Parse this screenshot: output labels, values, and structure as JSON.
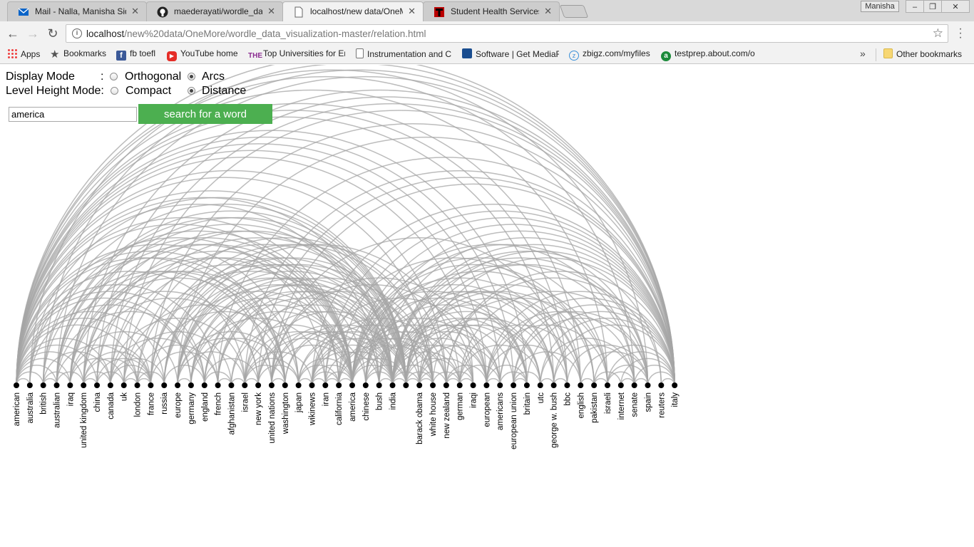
{
  "browser": {
    "tabs": [
      {
        "title": "Mail - Nalla, Manisha Sid",
        "icon": "outlook-mail-icon",
        "active": false
      },
      {
        "title": "maederayati/wordle_data",
        "icon": "github-icon",
        "active": false
      },
      {
        "title": "localhost/new data/OneM",
        "icon": "page-icon",
        "active": true
      },
      {
        "title": "Student Health Services",
        "icon": "texas-tech-icon",
        "active": false
      }
    ],
    "profile_name": "Manisha",
    "url_host": "localhost",
    "url_path": "/new%20data/OneMore/wordle_data_visualization-master/relation.html",
    "bookmarks": [
      {
        "label": "Apps",
        "icon": "apps-grid-icon"
      },
      {
        "label": "Bookmarks",
        "icon": "star-icon"
      },
      {
        "label": "fb toefl",
        "icon": "facebook-icon"
      },
      {
        "label": "YouTube home",
        "icon": "youtube-icon"
      },
      {
        "label": "Top Universities for Er",
        "icon": "the-icon"
      },
      {
        "label": "Instrumentation and C",
        "icon": "page-icon"
      },
      {
        "label": "Software | Get MediaF",
        "icon": "mediafire-icon"
      },
      {
        "label": "zbigz.com/myfiles",
        "icon": "zbigz-icon"
      },
      {
        "label": "testprep.about.com/o",
        "icon": "about-icon"
      }
    ],
    "overflow": "»",
    "other_bookmarks": "Other bookmarks",
    "colors": {
      "tabstrip": "#d9d9d9",
      "toolbar": "#f2f2f2"
    }
  },
  "page": {
    "display_mode": {
      "label": "Display Mode",
      "colon": ":",
      "options": [
        "Orthogonal",
        "Arcs"
      ],
      "selected": "Arcs"
    },
    "level_height_mode": {
      "label": "Level Height Mode:",
      "options": [
        "Compact",
        "Distance"
      ],
      "selected": "Distance"
    },
    "search": {
      "value": "america",
      "button_label": "search for a word"
    },
    "colors": {
      "button": "#4caf50",
      "arc": "#a6a6a6",
      "node": "#000000"
    }
  },
  "arc_diagram": {
    "nodes": [
      "american",
      "australia",
      "british",
      "australian",
      "iraq",
      "united kingdom",
      "china",
      "canada",
      "uk",
      "london",
      "france",
      "russia",
      "europe",
      "germany",
      "england",
      "french",
      "afghanistan",
      "israel",
      "new york",
      "united nations",
      "washington",
      "japan",
      "wikinews",
      "iran",
      "california",
      "america",
      "chinese",
      "bush",
      "india",
      "",
      "barack obama",
      "white house",
      "new zealand",
      "german",
      "iraqi",
      "european",
      "americans",
      "european union",
      "britain",
      "utc",
      "george w. bush",
      "bbc",
      "english",
      "pakistan",
      "israeli",
      "internet",
      "senate",
      "spain",
      "reuters",
      "italy"
    ]
  }
}
